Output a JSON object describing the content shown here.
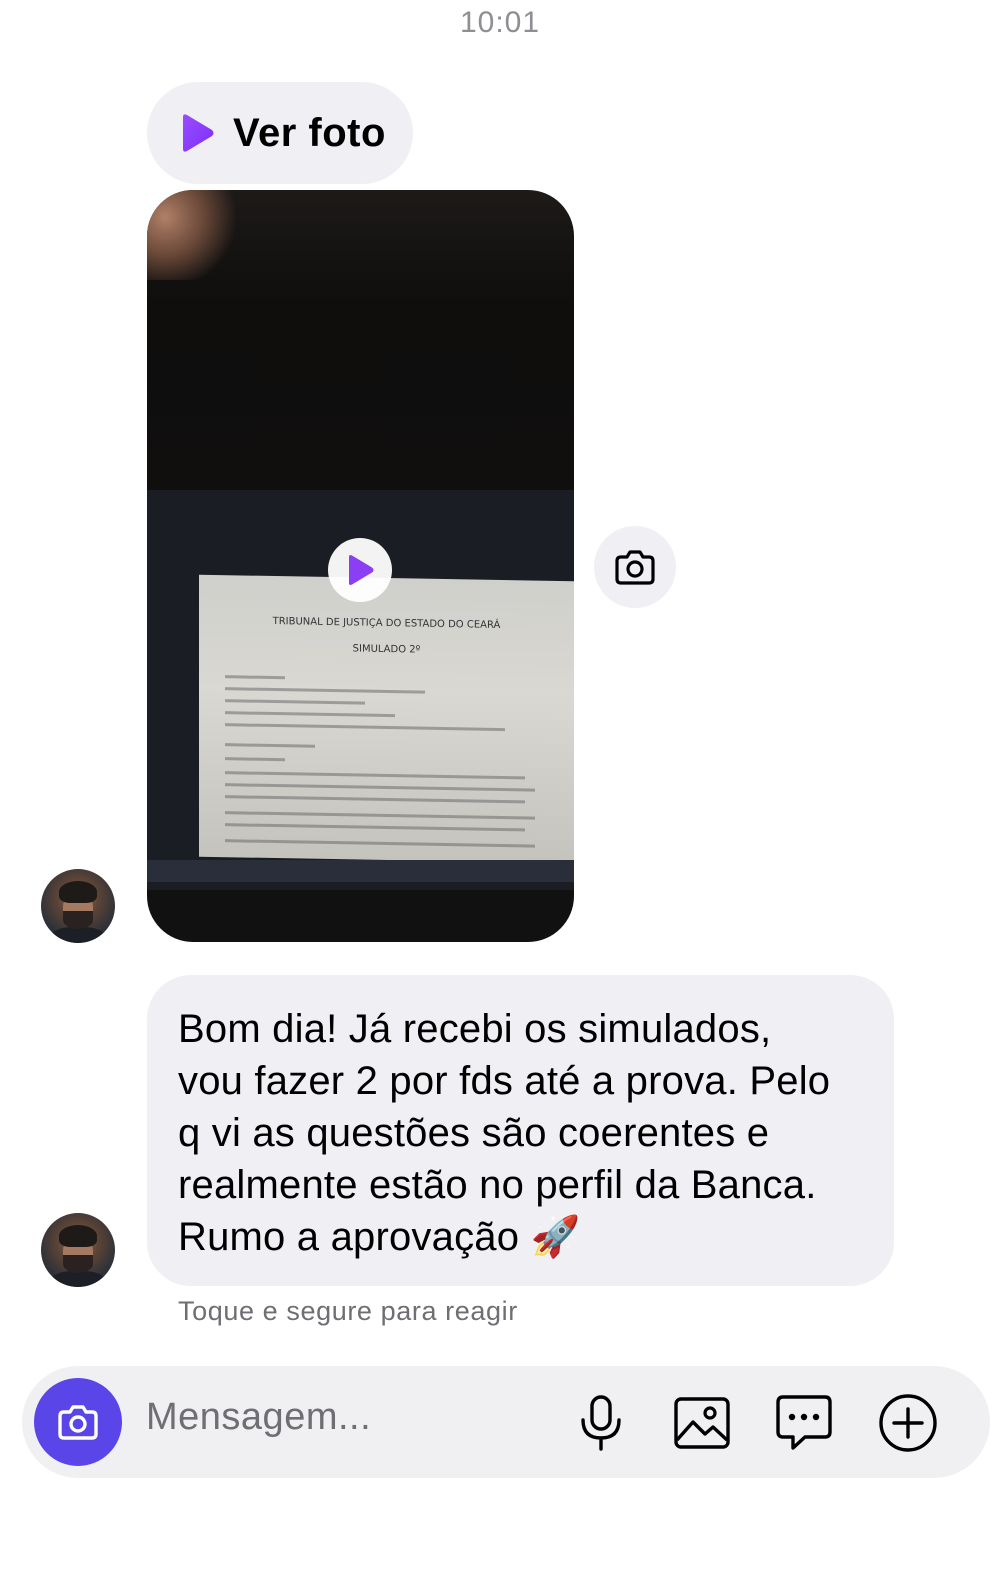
{
  "header": {
    "time": "10:01"
  },
  "view_once": {
    "label": "Ver foto"
  },
  "media": {
    "doc_title": "TRIBUNAL DE JUSTIÇA DO ESTADO DO CEARÁ",
    "doc_subtitle": "SIMULADO 2º"
  },
  "message": {
    "text": "Bom dia! Já recebi os simulados,\nvou fazer 2 por fds até a prova. Pelo\nq vi as questões são coerentes e\nrealmente estão no perfil da Banca.\nRumo a aprovação 🚀"
  },
  "react_hint": "Toque e segure para reagir",
  "composer": {
    "placeholder": "Mensagem...",
    "icons": [
      "camera-icon",
      "microphone-icon",
      "gallery-icon",
      "sticker-icon",
      "plus-icon"
    ]
  },
  "colors": {
    "accent": "#5a45e8",
    "play_gradient_start": "#9b4dff",
    "bubble": "#efeff4",
    "secondary_text": "#6e6e73"
  }
}
